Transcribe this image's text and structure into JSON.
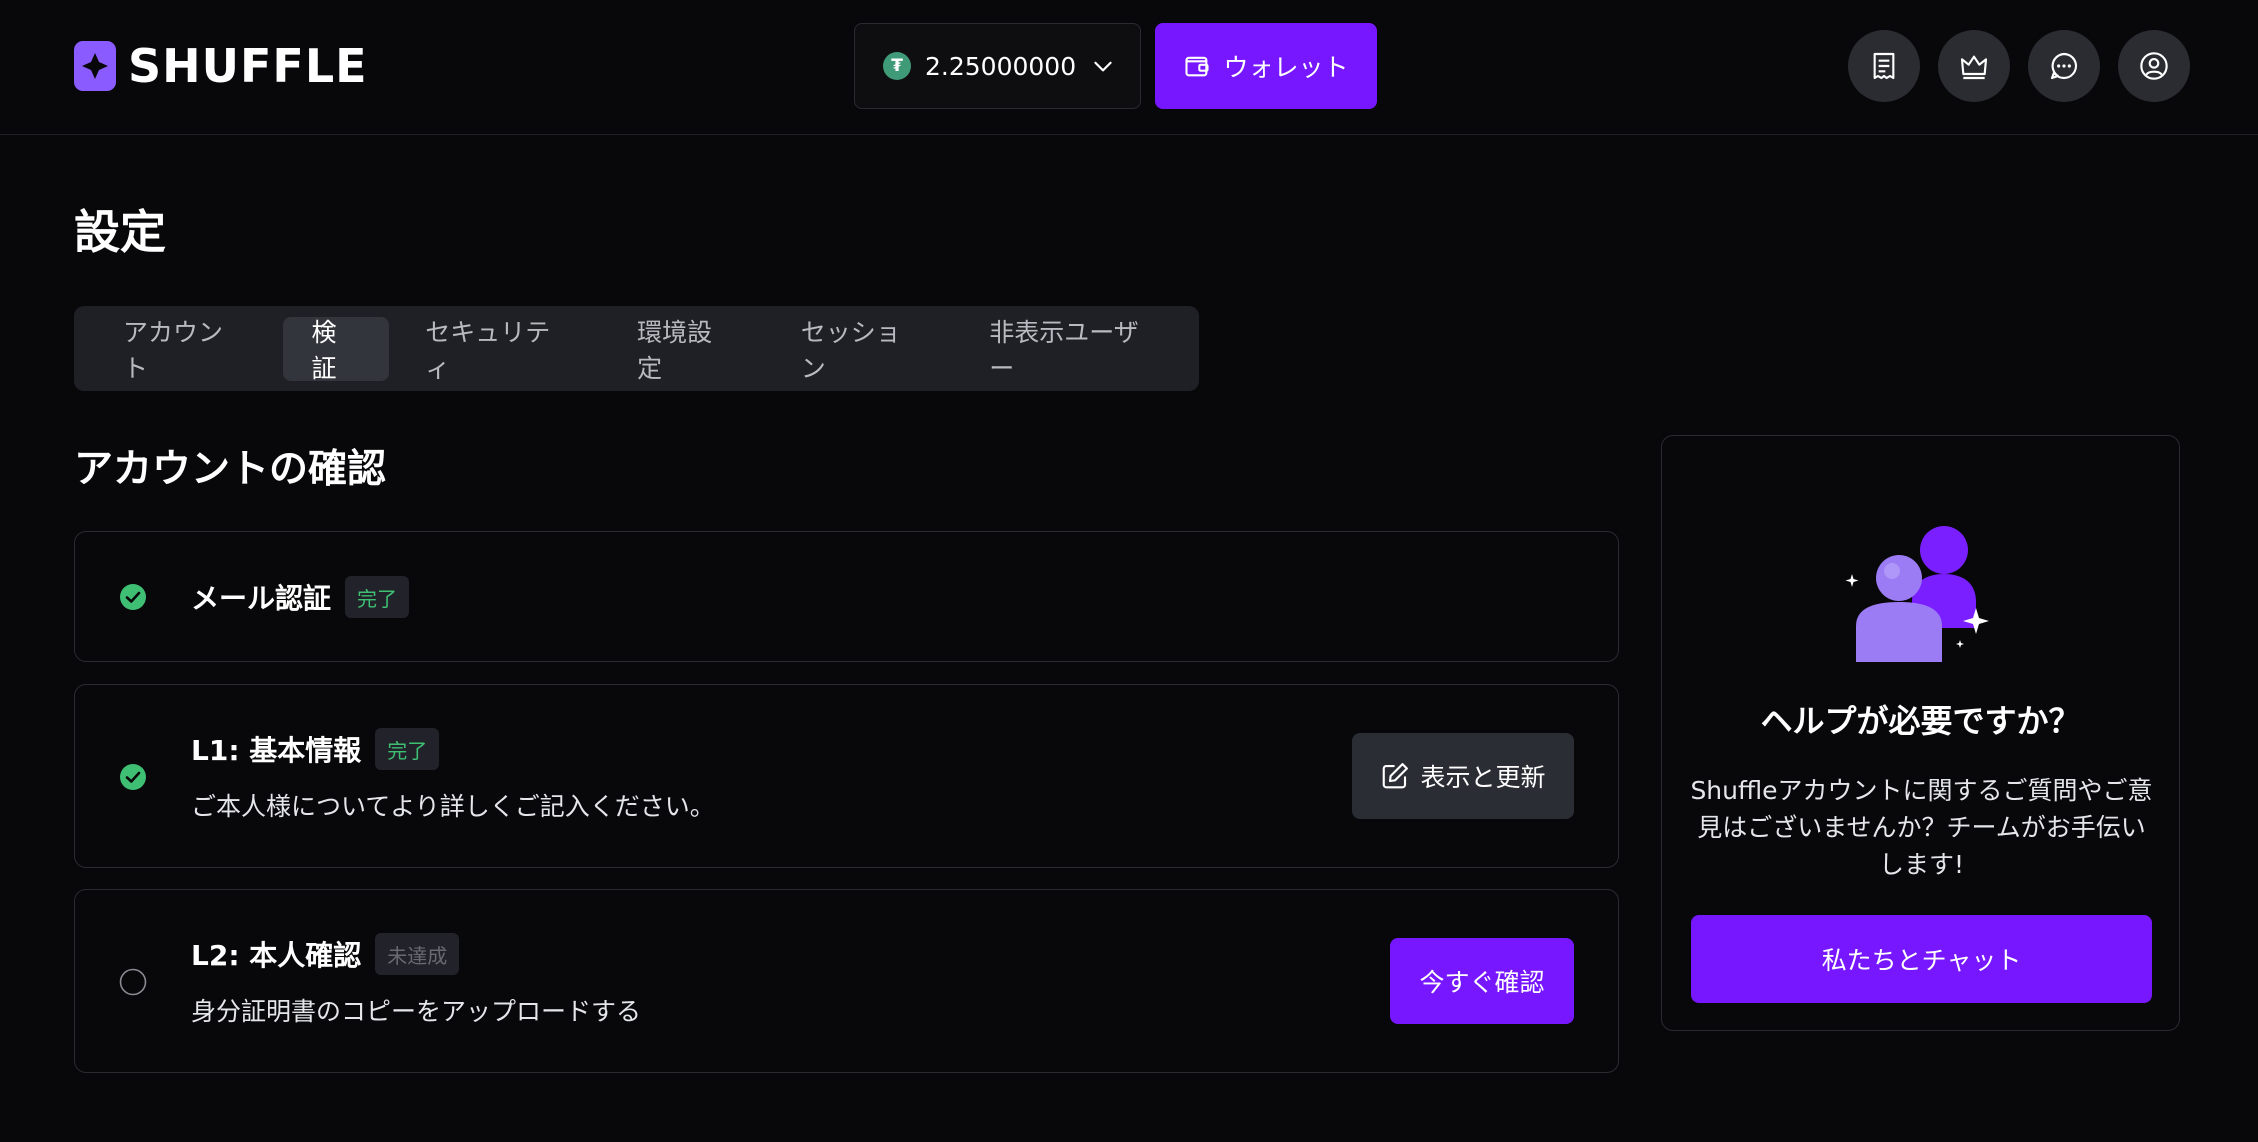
{
  "brand": {
    "name": "SHUFFLE",
    "accent": "#7717ff"
  },
  "header": {
    "balance": {
      "amount": "2.25000000",
      "currency_icon": "tether-icon"
    },
    "wallet_label": "ウォレット",
    "icons": [
      "receipt-icon",
      "crown-icon",
      "chat-icon",
      "user-icon"
    ]
  },
  "page": {
    "title": "設定"
  },
  "tabs": [
    {
      "label": "アカウント",
      "active": false
    },
    {
      "label": "検証",
      "active": true
    },
    {
      "label": "セキュリティ",
      "active": false
    },
    {
      "label": "環境設定",
      "active": false
    },
    {
      "label": "セッション",
      "active": false
    },
    {
      "label": "非表示ユーザー",
      "active": false
    }
  ],
  "verification": {
    "title": "アカウントの確認",
    "items": [
      {
        "title": "メール認証",
        "status": "完了",
        "done": true
      },
      {
        "title": "L1: 基本情報",
        "status": "完了",
        "done": true,
        "description": "ご本人様についてより詳しくご記入ください。",
        "action": "表示と更新"
      },
      {
        "title": "L2: 本人確認",
        "status": "未達成",
        "done": false,
        "description": "身分証明書のコピーをアップロードする",
        "action": "今すぐ確認"
      }
    ]
  },
  "help": {
    "title": "ヘルプが必要ですか？",
    "text_line1": "Shuffleアカウントに関するご質問やご意",
    "text_line2": "見はございませんか？チームがお手伝い",
    "text_line3": "します!",
    "button": "私たちとチャット"
  }
}
